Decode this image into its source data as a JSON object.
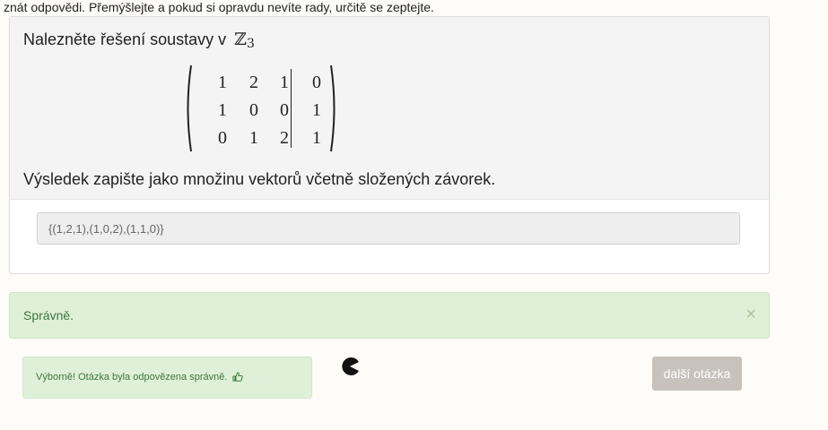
{
  "intro_text": "znát odpovědi. Přemýšlejte a pokud si opravdu nevíte rady, určitě se zeptejte.",
  "question": {
    "title_prefix": "Nalezněte řešení soustavy v",
    "ring_symbol": "ℤ",
    "ring_subscript": "3",
    "matrix": [
      [
        "1",
        "2",
        "1",
        "0"
      ],
      [
        "1",
        "0",
        "0",
        "1"
      ],
      [
        "0",
        "1",
        "2",
        "1"
      ]
    ],
    "instruction": "Výsledek zapište jako množinu vektorů včetně složených závorek."
  },
  "answer_value": "{(1,2,1),(1,0,2),(1,1,0)}",
  "alert": {
    "text": "Správně.",
    "close_glyph": "×"
  },
  "feedback": {
    "text": "Výborně! Otázka byla odpovězena správně.",
    "icon": "thumbs-up-icon"
  },
  "next_button": "další otázka",
  "colors": {
    "page_bg": "#fdfcf8",
    "success_bg": "#dff0d8",
    "success_text": "#3c763d",
    "button_bg": "#c8c2bc"
  }
}
